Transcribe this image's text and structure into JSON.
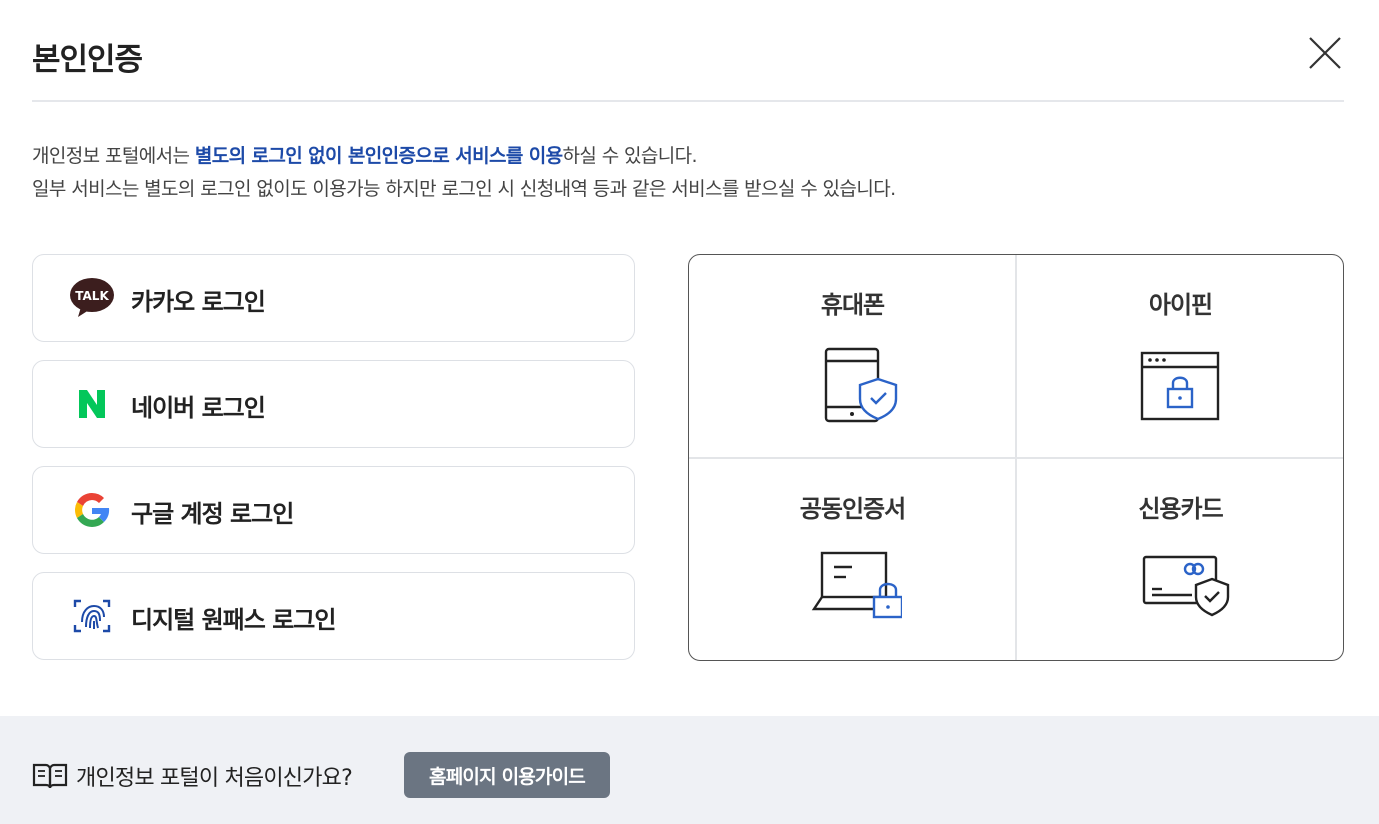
{
  "header": {
    "title": "본인인증"
  },
  "description": {
    "line1_pre": "개인정보 포털에서는 ",
    "line1_highlight": "별도의 로그인 없이 본인인증으로 서비스를 이용",
    "line1_post": "하실 수 있습니다.",
    "line2": "일부 서비스는 별도의 로그인 없이도 이용가능 하지만 로그인 시 신청내역 등과 같은 서비스를 받으실 수 있습니다."
  },
  "logins": [
    {
      "label": "카카오 로그인",
      "icon": "kakao-talk-icon",
      "icon_text": "TALK"
    },
    {
      "label": "네이버 로그인",
      "icon": "naver-icon"
    },
    {
      "label": "구글 계정 로그인",
      "icon": "google-icon"
    },
    {
      "label": "디지털 원패스 로그인",
      "icon": "fingerprint-icon"
    }
  ],
  "certs": [
    {
      "label": "휴대폰",
      "icon": "mobile-phone-shield-icon"
    },
    {
      "label": "아이핀",
      "icon": "browser-lock-icon"
    },
    {
      "label": "공동인증서",
      "icon": "laptop-lock-icon"
    },
    {
      "label": "신용카드",
      "icon": "credit-card-shield-icon"
    }
  ],
  "footer": {
    "question": "개인정보 포털이 처음이신가요?",
    "guide_button": "홈페이지 이용가이드",
    "icon": "book-icon"
  },
  "colors": {
    "accent": "#1d4aa8",
    "icon_blue": "#2b63c8",
    "kakao_brown": "#3c1e1e",
    "naver_green": "#03c75a",
    "guide_button_bg": "#6b7582",
    "footer_bg": "#eff1f5"
  }
}
